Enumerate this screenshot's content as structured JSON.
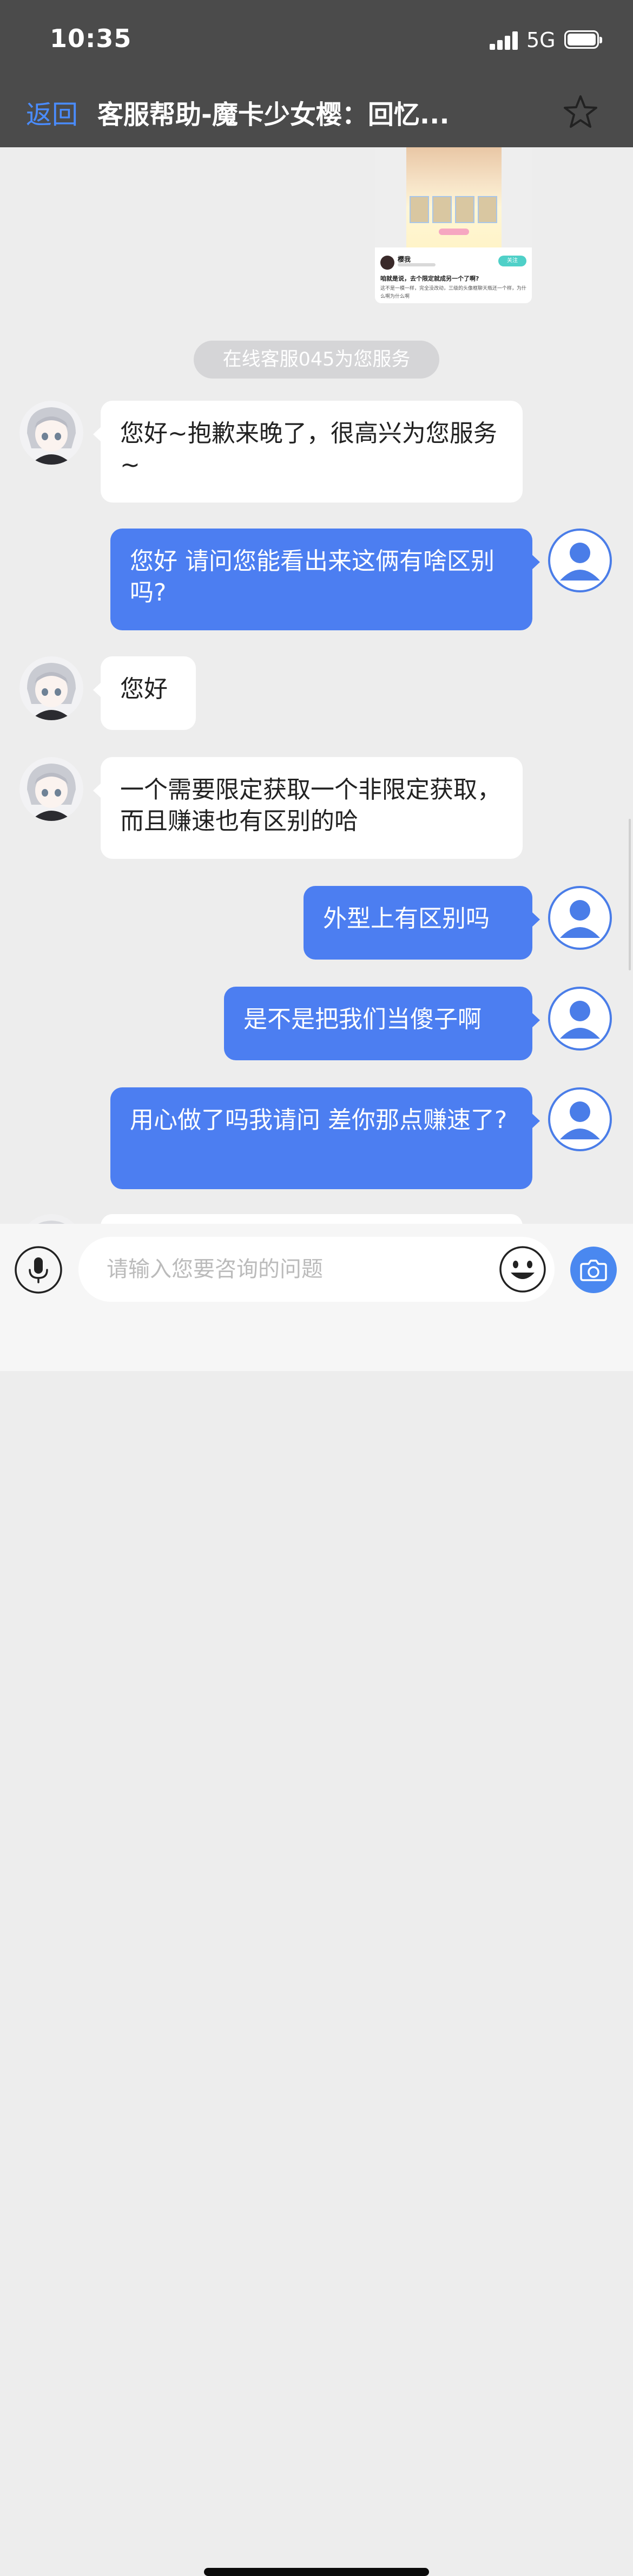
{
  "status_bar": {
    "time": "10:35",
    "network": "5G"
  },
  "nav": {
    "back_label": "返回",
    "title": "客服帮助-魔卡少女樱：回忆...",
    "favorite_icon": "star-outline-icon"
  },
  "shared_image": {
    "post_author": "樱我",
    "follow_label": "关注",
    "post_title": "咱就是说，去个限定就成另一个了啊?",
    "post_excerpt": "这不是一模一样，完全没改动，三级的头像框聊天瓶还一个样，为什么啊为什么啊"
  },
  "system_notice": "在线客服045为您服务",
  "messages": [
    {
      "sender": "agent",
      "text": "您好~抱歉来晚了，很高兴为您服务~"
    },
    {
      "sender": "user",
      "text": "您好 请问您能看出来这俩有啥区别吗?"
    },
    {
      "sender": "agent",
      "text": "您好"
    },
    {
      "sender": "agent",
      "text": "一个需要限定获取一个非限定获取，而且赚速也有区别的哈"
    },
    {
      "sender": "user",
      "text": "外型上有区别吗"
    },
    {
      "sender": "user",
      "text": "是不是把我们当傻子啊"
    },
    {
      "sender": "user",
      "text": "用心做了吗我请问 差你那点赚速了?"
    }
  ],
  "input": {
    "placeholder": "请输入您要咨询的问题",
    "mic_icon": "microphone-icon",
    "emoji_icon": "smiley-face-icon",
    "camera_icon": "camera-icon"
  },
  "colors": {
    "header_bg": "#4b4b4b",
    "accent_blue": "#4a8cff",
    "user_bubble": "#4c7ef1",
    "agent_bubble": "#ffffff",
    "chat_bg": "#ededed"
  }
}
